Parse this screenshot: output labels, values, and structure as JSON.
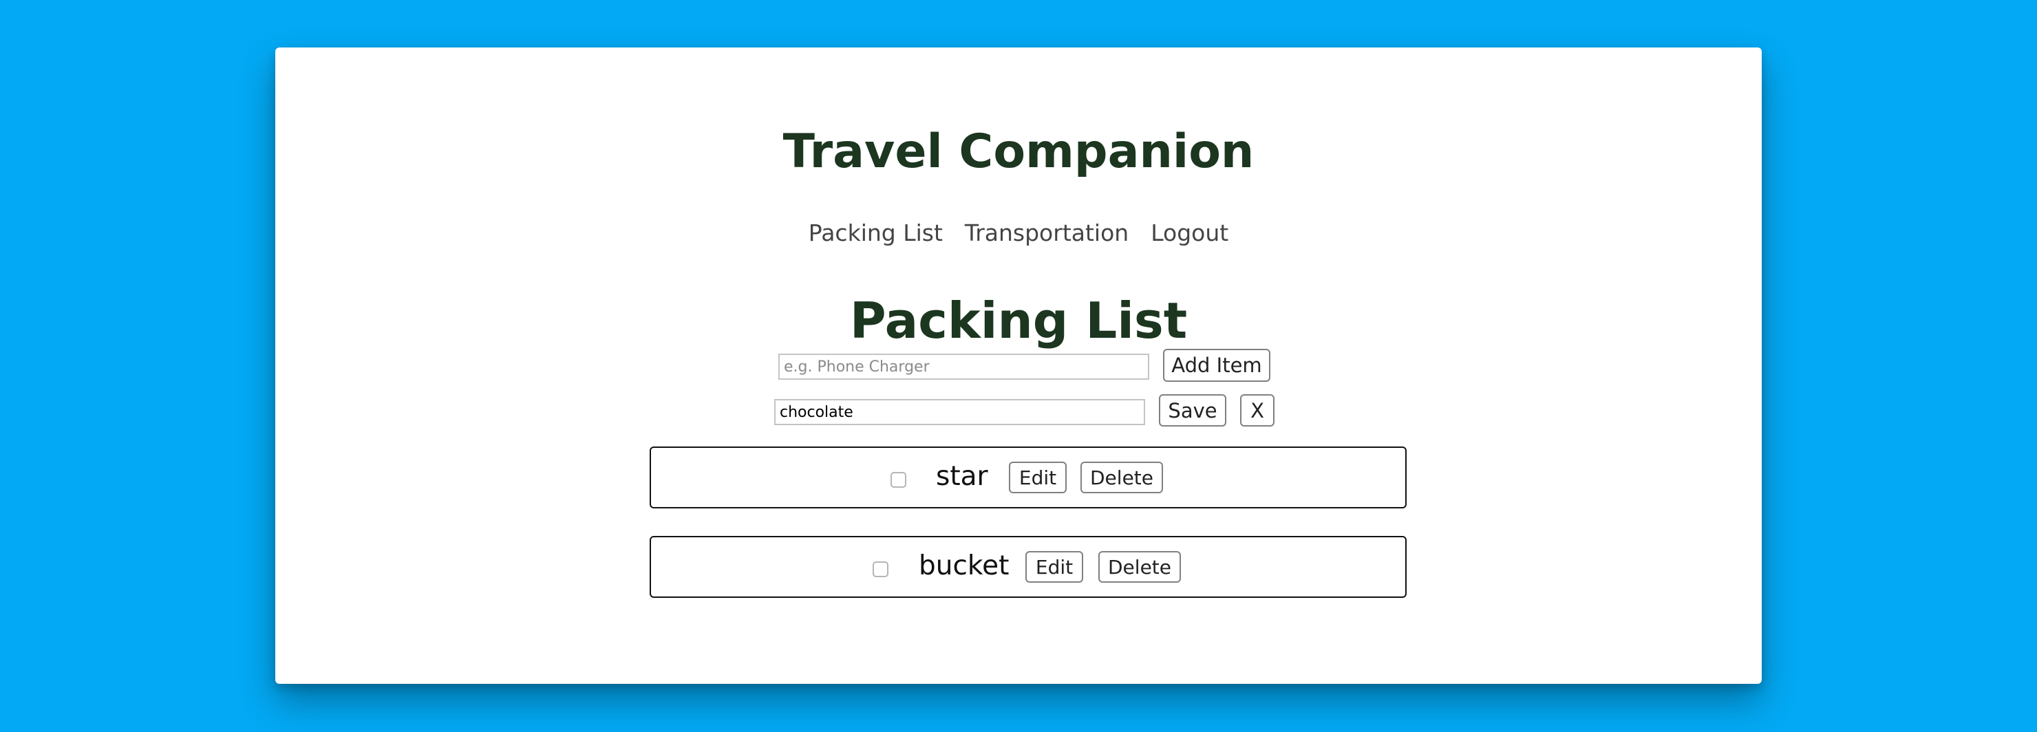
{
  "header": {
    "app_title": "Travel Companion"
  },
  "nav": {
    "items": [
      {
        "label": "Packing List"
      },
      {
        "label": "Transportation"
      },
      {
        "label": "Logout"
      }
    ]
  },
  "main": {
    "page_title": "Packing List",
    "add_form": {
      "placeholder": "e.g. Phone Charger",
      "value": "",
      "add_label": "Add Item"
    },
    "edit_form": {
      "value": "chocolate",
      "save_label": "Save",
      "cancel_label": "X"
    },
    "items": [
      {
        "name": "star",
        "checked": false,
        "edit_label": "Edit",
        "delete_label": "Delete"
      },
      {
        "name": "bucket",
        "checked": false,
        "edit_label": "Edit",
        "delete_label": "Delete"
      }
    ]
  }
}
